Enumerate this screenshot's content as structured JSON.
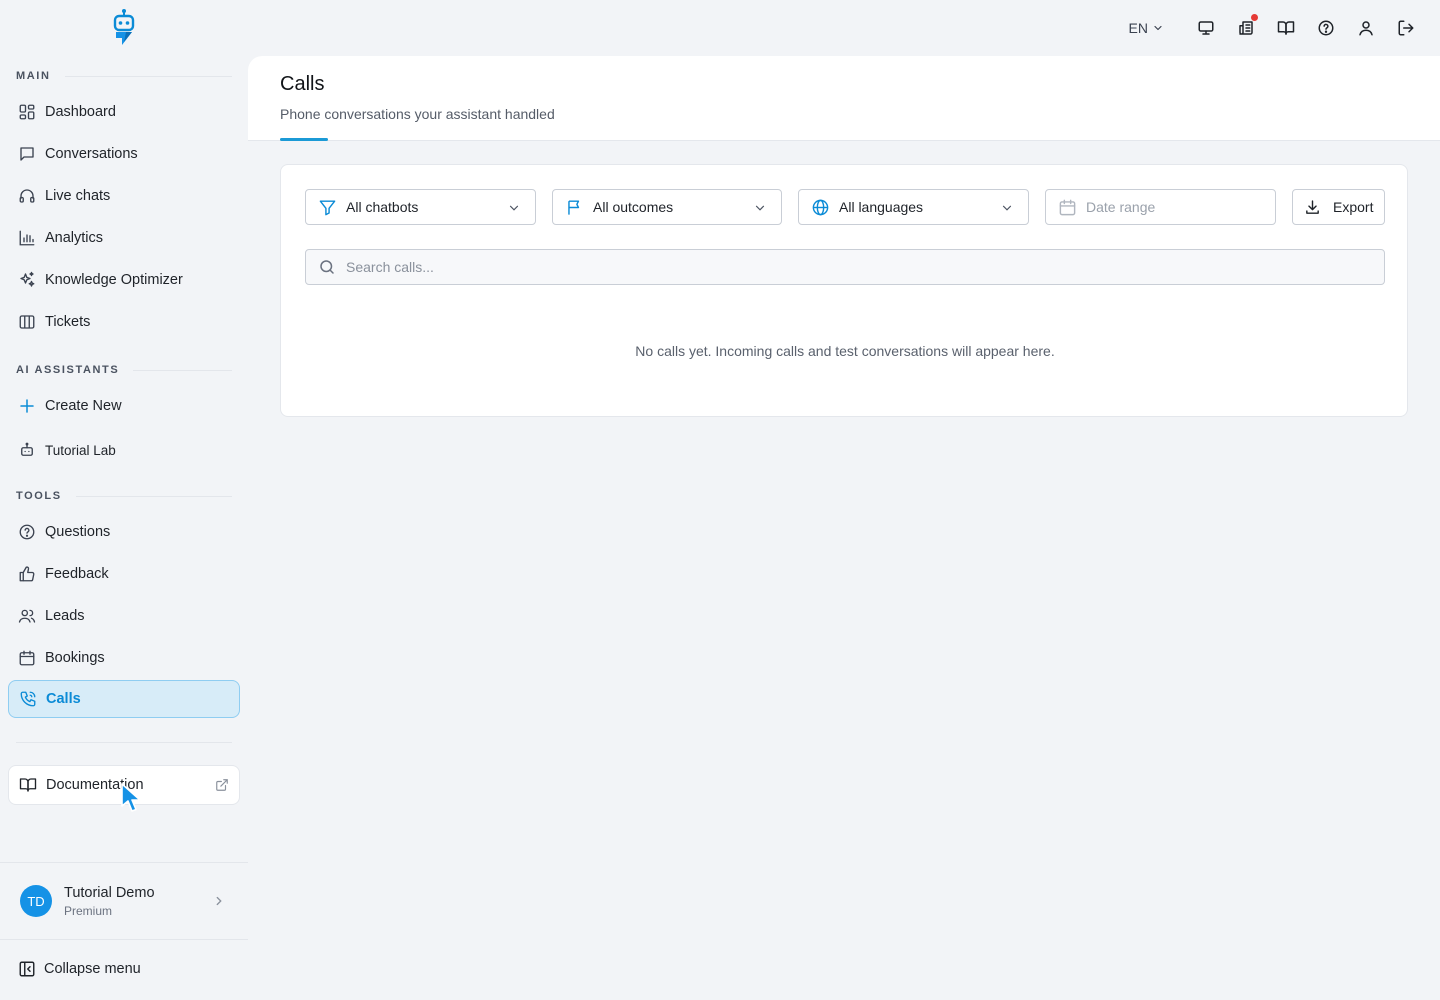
{
  "topbar": {
    "language": "EN",
    "icons": [
      "monitor-icon",
      "newspaper-icon",
      "book-open-icon",
      "help-circle-icon",
      "user-icon",
      "logout-icon"
    ]
  },
  "sidebar": {
    "sections": {
      "main": "MAIN",
      "ai_assistants": "AI ASSISTANTS",
      "tools": "TOOLS"
    },
    "main_items": [
      {
        "label": "Dashboard",
        "icon": "dashboard-icon"
      },
      {
        "label": "Conversations",
        "icon": "chat-bubble-icon"
      },
      {
        "label": "Live chats",
        "icon": "headset-icon"
      },
      {
        "label": "Analytics",
        "icon": "bar-chart-icon"
      },
      {
        "label": "Knowledge Optimizer",
        "icon": "sparkles-icon"
      },
      {
        "label": "Tickets",
        "icon": "columns-icon"
      }
    ],
    "assistant_items": [
      {
        "label": "Create New",
        "icon": "plus-icon"
      },
      {
        "label": "Tutorial Lab",
        "icon": "bot-icon"
      }
    ],
    "tool_items": [
      {
        "label": "Questions",
        "icon": "help-circle-icon"
      },
      {
        "label": "Feedback",
        "icon": "thumbs-up-icon"
      },
      {
        "label": "Leads",
        "icon": "users-icon"
      },
      {
        "label": "Bookings",
        "icon": "calendar-icon"
      },
      {
        "label": "Calls",
        "icon": "phone-icon",
        "active": true
      }
    ],
    "documentation": "Documentation",
    "user": {
      "initials": "TD",
      "name": "Tutorial Demo",
      "plan": "Premium"
    },
    "collapse_label": "Collapse menu"
  },
  "page": {
    "title": "Calls",
    "subtitle": "Phone conversations your assistant handled"
  },
  "filters": {
    "chatbots": "All chatbots",
    "outcomes": "All outcomes",
    "languages": "All languages",
    "date_placeholder": "Date range",
    "export_label": "Export"
  },
  "search": {
    "placeholder": "Search calls...",
    "value": ""
  },
  "empty_state": "No calls yet. Incoming calls and test conversations will appear here.",
  "colors": {
    "accent": "#0b8bd6",
    "active_bg": "#d7ecf8",
    "notification": "#e53935"
  }
}
